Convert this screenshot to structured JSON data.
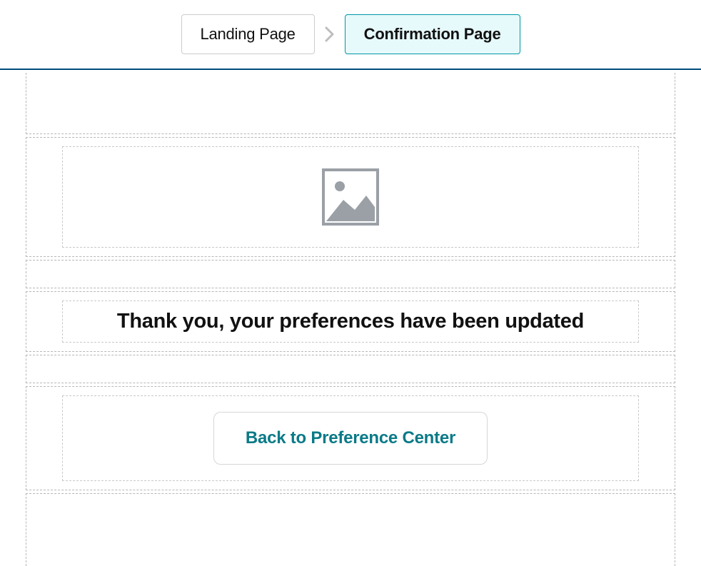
{
  "header": {
    "tabs": [
      {
        "label": "Landing Page",
        "active": false
      },
      {
        "label": "Confirmation Page",
        "active": true
      }
    ]
  },
  "content": {
    "heading": "Thank you, your preferences have been updated",
    "button_label": "Back to Preference Center"
  },
  "colors": {
    "accent": "#0a7a87",
    "tab_active_bg": "#e6f9fb",
    "tab_active_border": "#0096a6",
    "header_border": "#004c7a"
  }
}
